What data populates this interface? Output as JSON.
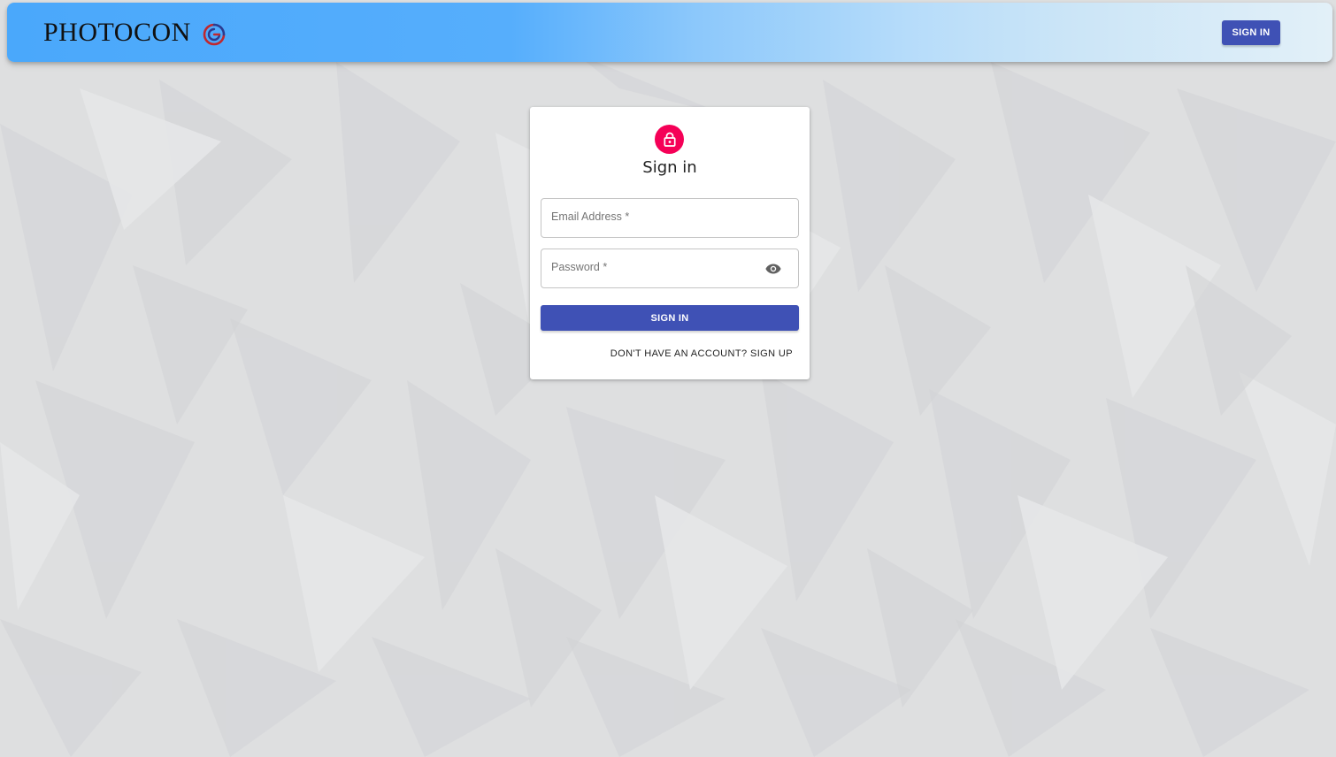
{
  "app": {
    "brand_name": "PHOTOCON",
    "brand_logo_icon": "photocon-ring-logo",
    "nav_signin_label": "SIGN IN"
  },
  "signin_card": {
    "avatar_icon": "lock-icon",
    "title": "Sign in",
    "email_field": {
      "label": "Email Address *",
      "value": ""
    },
    "password_field": {
      "label": "Password *",
      "value": "",
      "toggle_icon": "eye-icon"
    },
    "submit_label": "SIGN IN",
    "signup_link_label": "DON'T HAVE AN ACCOUNT? SIGN UP"
  },
  "colors": {
    "primary": "#3f51b5",
    "avatar_accent": "#f50057",
    "appbar_gradient_start": "#4aa8fb",
    "appbar_gradient_end": "#e2f0f8",
    "background": "#dfe0e1"
  }
}
